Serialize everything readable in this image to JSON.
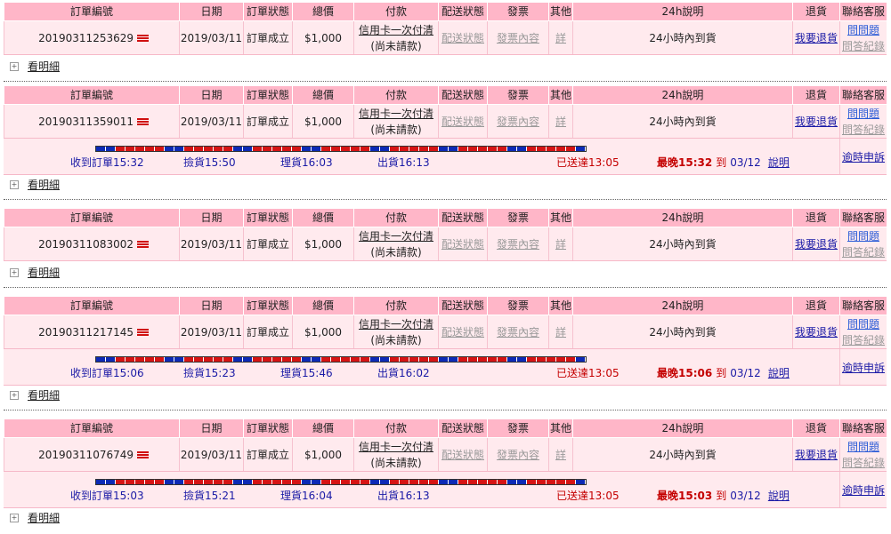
{
  "headers": {
    "order_no": "訂單編號",
    "date": "日期",
    "status": "訂單狀態",
    "total": "總價",
    "payment": "付款",
    "delivery": "配送狀態",
    "invoice": "發票",
    "other": "其他",
    "info24h": "24h說明",
    "return": "退貨",
    "service": "聯絡客服"
  },
  "row_labels": {
    "payment_link": "信用卡一次付清",
    "payment_note": "(尚未請款)",
    "delivery_link": "配送狀態",
    "invoice_link": "發票內容",
    "other_link": "詳",
    "return_link": "我要退貨",
    "ask_link": "問問題",
    "history_link": "問答紀錄",
    "detail_link": "看明細",
    "late_link": "逾時申訴",
    "explain_link": "說明",
    "latest_prefix": "最晚",
    "to_word": "到",
    "delivered_prefix": "已送達",
    "received_prefix": "收到訂單",
    "pick_prefix": "撿貨",
    "sort_prefix": "理貨",
    "ship_prefix": "出貨",
    "expand_icon_char": "+"
  },
  "orders": [
    {
      "order_no": "20190311253629",
      "date": "2019/03/11",
      "status": "訂單成立",
      "total": "$1,000",
      "info": "24小時內到貨",
      "tracking": null
    },
    {
      "order_no": "20190311359011",
      "date": "2019/03/11",
      "status": "訂單成立",
      "total": "$1,000",
      "info": "24小時內到貨",
      "tracking": {
        "received": "15:32",
        "picked": "15:50",
        "sorted": "16:03",
        "shipped": "16:13",
        "delivered": "13:05",
        "latest_time": "15:32",
        "latest_date": "03/12"
      }
    },
    {
      "order_no": "20190311083002",
      "date": "2019/03/11",
      "status": "訂單成立",
      "total": "$1,000",
      "info": "24小時內到貨",
      "tracking": null
    },
    {
      "order_no": "20190311217145",
      "date": "2019/03/11",
      "status": "訂單成立",
      "total": "$1,000",
      "info": "24小時內到貨",
      "tracking": {
        "received": "15:06",
        "picked": "15:23",
        "sorted": "15:46",
        "shipped": "16:02",
        "delivered": "13:05",
        "latest_time": "15:06",
        "latest_date": "03/12"
      }
    },
    {
      "order_no": "20190311076749",
      "date": "2019/03/11",
      "status": "訂單成立",
      "total": "$1,000",
      "info": "24小時內到貨",
      "tracking": {
        "received": "15:03",
        "picked": "15:21",
        "sorted": "16:04",
        "shipped": "16:13",
        "delivered": "13:05",
        "latest_time": "15:03",
        "latest_date": "03/12"
      }
    }
  ],
  "colors": {
    "header_bg": "#ffb6c8",
    "row_bg": "#ffeaee",
    "link": "#1a1aa6",
    "alert": "#c40000",
    "bar_blue": "#0d2ab5",
    "bar_red": "#d51414"
  },
  "progress_pattern": "bbrrrrrbbrrrrrbbrrrrrbbrrrrrbbrrrrrbbrrrrrbbrrrrrb"
}
